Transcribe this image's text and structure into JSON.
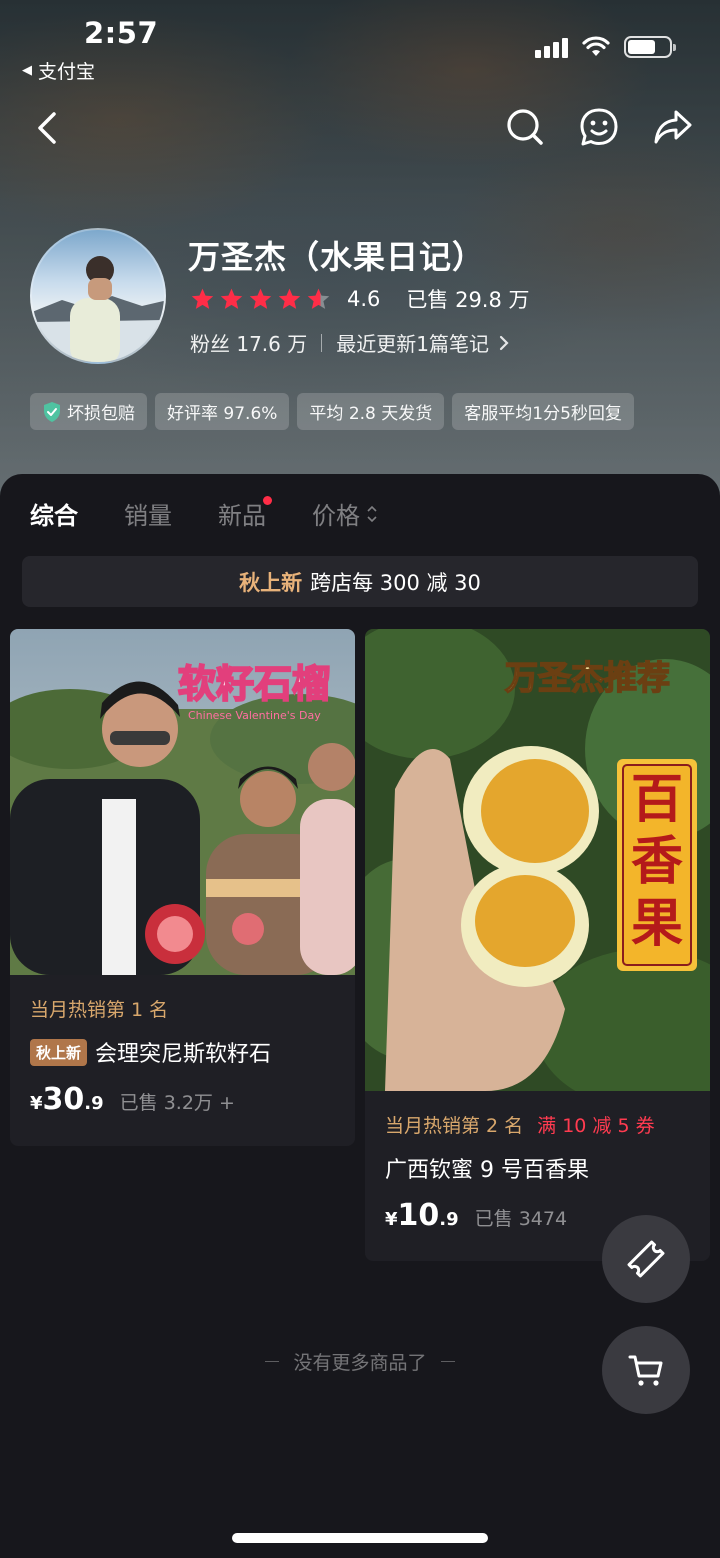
{
  "status_bar": {
    "time": "2:57",
    "back_app": "支付宝"
  },
  "nav": {
    "back_icon": "chevron-left-icon",
    "search_icon": "search-icon",
    "service_icon": "customer-service-icon",
    "share_icon": "share-icon"
  },
  "shop": {
    "name": "万圣杰（水果日记）",
    "rating": "4.6",
    "rating_value": 4.6,
    "sold": "已售 29.8 万",
    "fans": "粉丝 17.6 万",
    "recent_update": "最近更新1篇笔记",
    "badges": [
      "坏损包赔",
      "好评率 97.6%",
      "平均 2.8 天发货",
      "客服平均1分5秒回复"
    ]
  },
  "tabs": [
    {
      "label": "综合",
      "active": true
    },
    {
      "label": "销量",
      "active": false
    },
    {
      "label": "新品",
      "active": false
    },
    {
      "label": "价格",
      "active": false
    }
  ],
  "promo": {
    "tag": "秋上新",
    "text": "跨店每 300 减 30"
  },
  "products": [
    {
      "image_overlay": "软籽石榴",
      "image_subtitle": "Chinese Valentine's Day",
      "rank": "当月热销第 1 名",
      "tag": "秋上新",
      "title": "会理突尼斯软籽石",
      "currency": "¥",
      "price_int": "30",
      "price_dec": ".9",
      "sold": "已售 3.2万 +"
    },
    {
      "image_overlay": "万圣杰推荐",
      "image_side_text": "百香果",
      "rank": "当月热销第 2 名",
      "coupon": "满 10 减 5 券",
      "title": "广西钦蜜 9 号百香果",
      "currency": "¥",
      "price_int": "10",
      "price_dec": ".9",
      "sold": "已售 3474"
    }
  ],
  "footer": {
    "no_more": "没有更多商品了"
  },
  "colors": {
    "accent_gold": "#d8a76c",
    "star_red": "#ff2d47",
    "coupon_red": "#ff3b50",
    "background": "#17171c"
  }
}
